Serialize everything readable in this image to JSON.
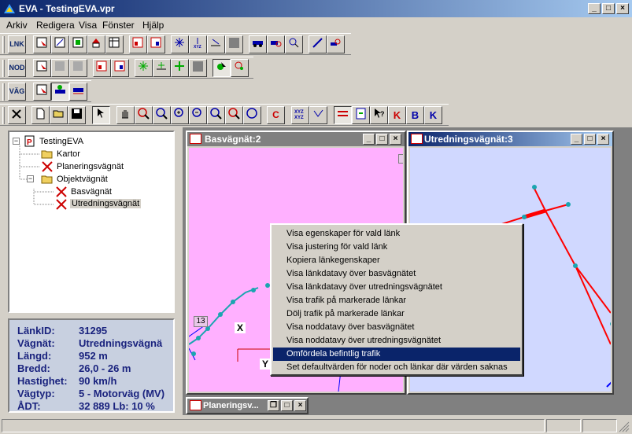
{
  "window": {
    "title": "EVA - TestingEVA.vpr"
  },
  "menu": [
    "Arkiv",
    "Redigera",
    "Visa",
    "Fönster",
    "Hjälp"
  ],
  "toolbar": {
    "lnk_label": "LNK",
    "nod_label": "NOD",
    "vag_label": "VÄG",
    "c_label": "C",
    "k_label": "K",
    "b_label": "B",
    "k2_label": "K"
  },
  "tree": {
    "root": "TestingEVA",
    "items": [
      {
        "label": "Kartor"
      },
      {
        "label": "Planeringsvägnät"
      },
      {
        "label": "Objektvägnät"
      },
      {
        "label": "Basvägnät"
      },
      {
        "label": "Utredningsvägnät"
      }
    ],
    "expand_symbol": "−"
  },
  "info": {
    "rows": [
      {
        "key": "LänkID:",
        "value": "31295"
      },
      {
        "key": "Vägnät:",
        "value": "Utredningsvägnä"
      },
      {
        "key": "Längd:",
        "value": "952 m"
      },
      {
        "key": "Bredd:",
        "value": "26,0 - 26 m"
      },
      {
        "key": "Hastighet:",
        "value": "90 km/h"
      },
      {
        "key": "Vägtyp:",
        "value": "5 - Motorväg (MV)"
      },
      {
        "key": "ÅDT:",
        "value": "32  889  Lb: 10 %"
      }
    ]
  },
  "windows": {
    "bas": {
      "title": "Basvägnät:2",
      "map_label": "13",
      "axis_x": "X",
      "axis_y": "Y"
    },
    "utr": {
      "title": "Utredningsvägnät:3"
    },
    "plan": {
      "title": "Planeringsv..."
    }
  },
  "context_menu": {
    "items": [
      "Visa egenskaper för vald länk",
      "Visa justering för vald länk",
      "Kopiera länkegenskaper",
      "Visa länkdatavy över basvägnätet",
      "Visa länkdatavy över utredningsvägnätet",
      "Visa trafik på markerade länkar",
      "Dölj trafik på markerade länkar",
      "Visa noddatavy över basvägnätet",
      "Visa noddatavy över utredningsvägnätet",
      "Omfördela befintlig trafik",
      "Set defaultvärden för noder och länkar där värden saknas"
    ],
    "highlighted_index": 9
  },
  "colors": {
    "bas_bg": "#ffb0ff",
    "utr_bg": "#d0d8ff",
    "link_red": "#ff0000",
    "node_cyan": "#1aa5b0",
    "highlight": "#0a246a"
  }
}
